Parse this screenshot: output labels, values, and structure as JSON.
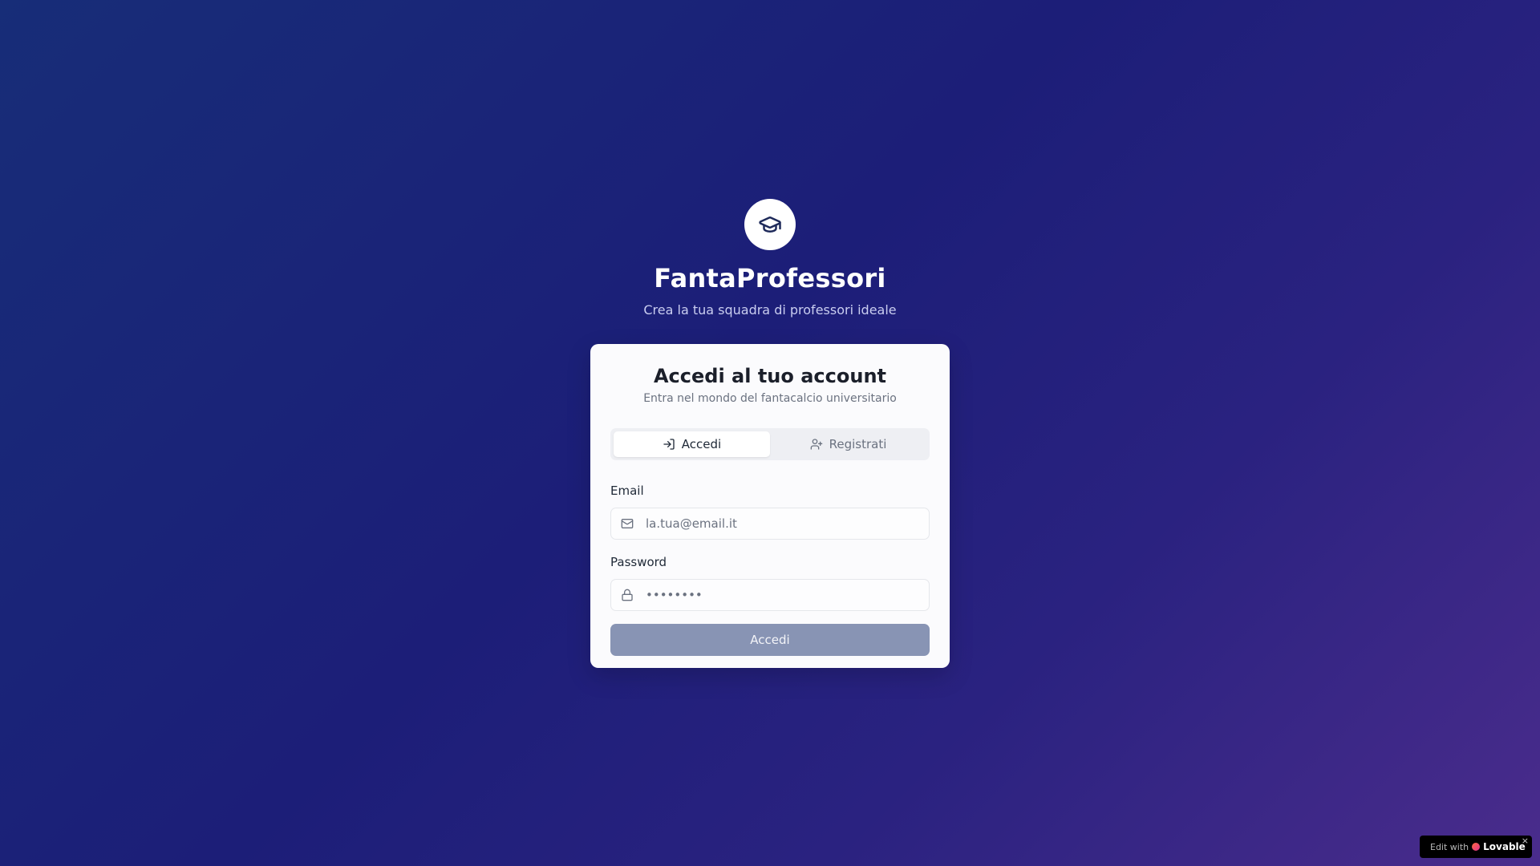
{
  "header": {
    "logo_icon": "graduation-cap-icon",
    "app_title": "FantaProfessori",
    "app_subtitle": "Crea la tua squadra di professori ideale"
  },
  "card": {
    "title": "Accedi al tuo account",
    "subtitle": "Entra nel mondo del fantacalcio universitario"
  },
  "tabs": [
    {
      "label": "Accedi",
      "icon": "log-in-icon",
      "active": true
    },
    {
      "label": "Registrati",
      "icon": "user-plus-icon",
      "active": false
    }
  ],
  "form": {
    "email_label": "Email",
    "email_placeholder": "la.tua@email.it",
    "email_value": "",
    "password_label": "Password",
    "password_placeholder": "••••••••",
    "password_value": "",
    "submit_label": "Accedi"
  },
  "badge": {
    "edit_text": "Edit with",
    "brand": "Lovable",
    "close": "×"
  },
  "colors": {
    "submit_button": "#8894b4",
    "card_background": "#fbfbfd"
  }
}
